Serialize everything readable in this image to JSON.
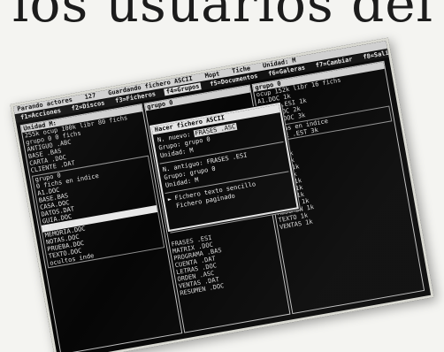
{
  "headline": "los usuarios del PCW.",
  "statusbar": {
    "items": [
      "Parando actores",
      "127",
      "Guardando fichero ASCII",
      "Mopt",
      "Tiche",
      "Unidad: M"
    ]
  },
  "menubar": {
    "items": [
      "f1=Acciones",
      "f2=Discos",
      "f3=Ficheros",
      "f4=Grupos",
      "f5=Documentos",
      "f6=Galeras",
      "f7=Cambiar",
      "f8=Salir"
    ],
    "selected_index": 3
  },
  "left_pane": {
    "header": "Unidad M:",
    "summary": "255k ocup  100k libr  80 fichs",
    "lines": [
      "grupo 0   0 fichs",
      "ANTIGUO  .ABC",
      "BASE     .BAS",
      "CARTA    .DOC",
      "CLIENTE  .DAT"
    ],
    "group_header": "grupo 0",
    "group_summary": "0 fichs en   indice",
    "group_lines": [
      "A1.DOC",
      "BASE.BAS",
      "CASA.DOC",
      "DATOS.DAT",
      "GUIA.DOC",
      "LIBRO.DOC",
      "MEMORIA.DOC",
      "NOTAS.DOC",
      "PRUEBA.DOC",
      "TEXTO.DOC"
    ],
    "highlight_index": 5,
    "footer": "ocultos  inde"
  },
  "mid_pane": {
    "header": "grupo 0",
    "lines": [
      "FRASES   .ESI",
      "MATRIX   .DOC",
      "PROGRAMA .BAS",
      "CUENTA   .DAT",
      "LETRAS   .DOC",
      "ORDEN    .ASC",
      "VENTAS   .DAT",
      "RESUMEN  .DOC"
    ]
  },
  "right_pane": {
    "header": "grupo 0",
    "summary": "ocup  152k libr  16 fichs",
    "top_lines": [
      "A1.DOC       1k",
      "FRASES.ESI   1k",
      "GUIA.DOC     2k",
      "LIBRO.DOC    3k"
    ],
    "group_header": "1 fichs en   indice",
    "group_item": "FLAUTE  .EST   3k",
    "list_lines": [
      "A1       1k",
      "BASE     1k",
      "CASA     1k",
      "DATOS    1k",
      "GUIA     1k",
      "LIBRO    1k",
      "NOTAS    1k",
      "ORDEN    1k",
      "PRUEBA   1k",
      "RESUMEN  1k",
      "TEXTO    1k",
      "VENTAS   1k"
    ]
  },
  "dialog": {
    "title": "Hacer fichero ASCII",
    "new_name_label": "N. nuevo:",
    "new_name_value": "FRASES  .ASC",
    "new_group_label": "Grupo:",
    "new_group_value": "grupo 0",
    "new_drive_label": "Unidad:",
    "new_drive_value": "M",
    "old_name_label": "N. antiguo:",
    "old_name_value": "FRASES  .ESI",
    "old_group_label": "Grupo:",
    "old_group_value": "grupo 0",
    "old_drive_label": "Unidad:",
    "old_drive_value": "M",
    "options": [
      "Fichero texto sencillo",
      "Fichero paginado"
    ],
    "selected_option": 0
  }
}
